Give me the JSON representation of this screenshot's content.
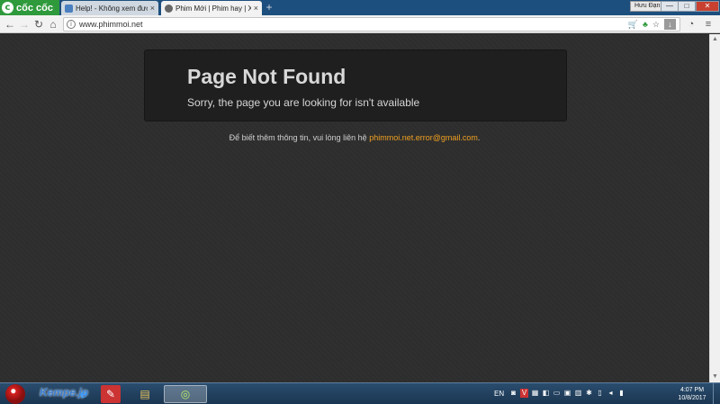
{
  "browser": {
    "brand": "cốc cốc",
    "tabs": [
      {
        "title": "Help! - Không xem được p",
        "close": "×",
        "active": false
      },
      {
        "title": "Phim Mới | Phim hay | Xem",
        "close": "×",
        "active": true
      }
    ],
    "new_tab": "+",
    "profile_label": "Hưu Đạn",
    "window_controls": {
      "minimize": "—",
      "maximize": "□",
      "close": "✕"
    },
    "nav": {
      "back": "←",
      "forward": "→",
      "reload": "↻",
      "home": "⌂"
    },
    "address": {
      "info": "i",
      "url": "www.phimmoi.net"
    },
    "omnibox_icons": {
      "cart": "🛒",
      "leaf": "♣",
      "star": "☆",
      "download": "↓"
    },
    "toolbar_right": {
      "speed": "◔",
      "menu": "≡"
    }
  },
  "page": {
    "title": "Page Not Found",
    "subtitle": "Sorry, the page you are looking for isn't available",
    "contact_text": "Để biết thêm thông tin, vui lòng liên hệ ",
    "contact_email": "phimmoi.net.error@gmail.com",
    "contact_end": "."
  },
  "scrollbar": {
    "up": "▲",
    "down": "▼"
  },
  "taskbar": {
    "watermark": "Kempe.jp",
    "apps": [
      "e",
      "✎",
      "▤",
      "◎"
    ],
    "lang": "EN",
    "tray_icons": [
      "◙",
      "V",
      "▦",
      "◧",
      "▭",
      "▣",
      "▥",
      "✱",
      "▯",
      "◂",
      "▮"
    ],
    "time": "4:07 PM",
    "date": "10/8/2017"
  },
  "colors": {
    "titlebar": "#1d4f7e",
    "brand_green": "#2f9a3c",
    "page_bg": "#2d2d2d",
    "box_bg": "#1f1f1f",
    "email": "#f0a020"
  }
}
